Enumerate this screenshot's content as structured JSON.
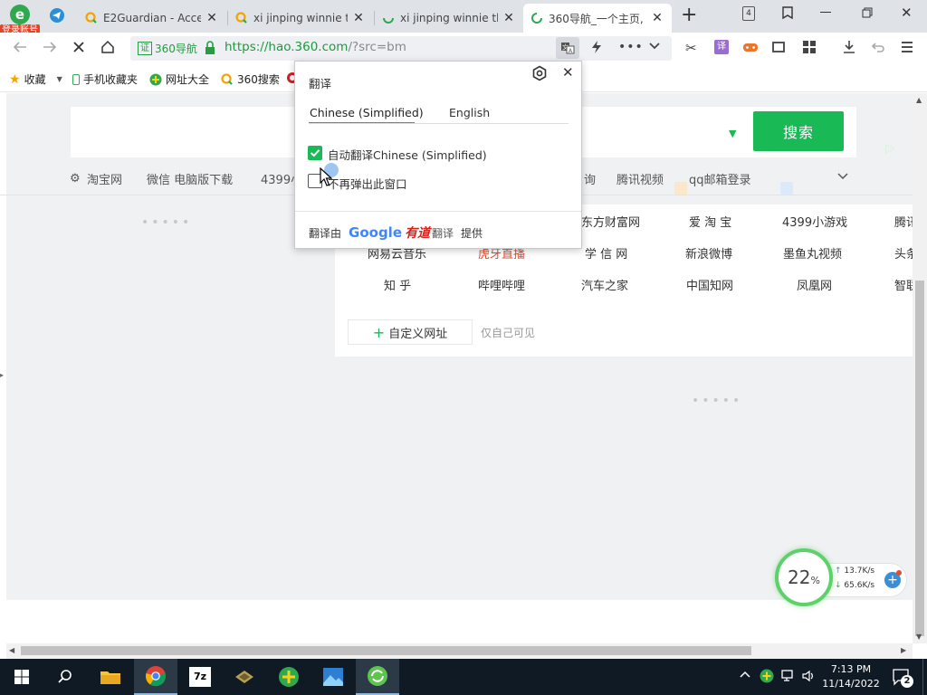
{
  "browser": {
    "badge": "登录账号",
    "tabs": [
      {
        "title": "E2Guardian - Acce"
      },
      {
        "title": "xi jinping winnie th"
      },
      {
        "title": "xi jinping winnie th"
      },
      {
        "title": "360导航_一个主页,"
      }
    ],
    "tab_count": "4",
    "address": {
      "site_label": "360导航",
      "url_main": "https://hao.360.com",
      "url_rest": "/?src=bm"
    }
  },
  "bookmarks": [
    {
      "label": "收藏"
    },
    {
      "label": "手机收藏夹"
    },
    {
      "label": "网址大全"
    },
    {
      "label": "360搜索"
    }
  ],
  "search": {
    "button": "搜索"
  },
  "hot_links": [
    "淘宝网",
    "微信 电脑版下载",
    "4399小",
    "询",
    "腾讯视频",
    "qq邮箱登录"
  ],
  "sites": [
    [
      "东方财富网",
      "爱 淘 宝",
      "4399小游戏",
      "腾讯"
    ],
    [
      "网易云音乐",
      "虎牙直播",
      "学 信 网",
      "新浪微博",
      "墨鱼丸视频",
      "头条"
    ],
    [
      "知 乎",
      "哔哩哔哩",
      "汽车之家",
      "中国知网",
      "凤凰网",
      "智联"
    ]
  ],
  "custom_site": {
    "label": "自定义网址",
    "note": "仅自己可见"
  },
  "translate_popup": {
    "title": "翻译",
    "tabs": [
      "Chinese (Simplified)",
      "English"
    ],
    "auto_translate": {
      "label": "自动翻译Chinese (Simplified)",
      "checked": true
    },
    "dont_show": {
      "label": "不再弹出此窗口",
      "checked": false
    },
    "footer_prefix": "翻译由",
    "footer_google": "Google",
    "footer_youdao": "有道",
    "footer_translate": "翻译",
    "footer_suffix": "提供"
  },
  "speed_widget": {
    "percent": "22",
    "percent_sign": "%",
    "up": "13.7K/s",
    "down": "65.6K/s"
  },
  "taskbar": {
    "time": "7:13 PM",
    "date": "11/14/2022",
    "notifications": "2"
  }
}
